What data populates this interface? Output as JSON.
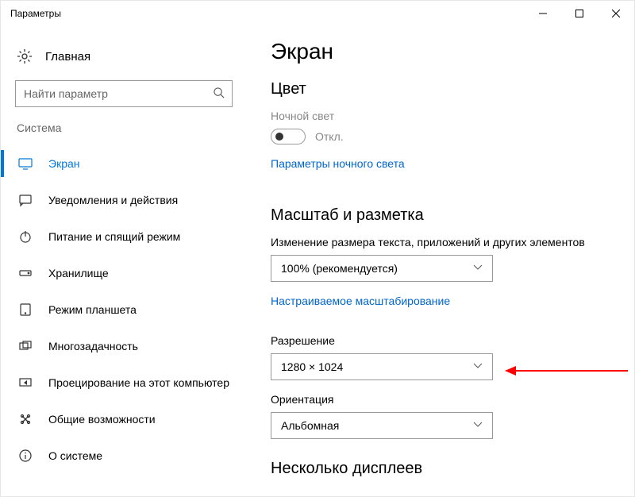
{
  "window": {
    "title": "Параметры"
  },
  "sidebar": {
    "home": "Главная",
    "search_placeholder": "Найти параметр",
    "category": "Система",
    "items": [
      {
        "label": "Экран"
      },
      {
        "label": "Уведомления и действия"
      },
      {
        "label": "Питание и спящий режим"
      },
      {
        "label": "Хранилище"
      },
      {
        "label": "Режим планшета"
      },
      {
        "label": "Многозадачность"
      },
      {
        "label": "Проецирование на этот компьютер"
      },
      {
        "label": "Общие возможности"
      },
      {
        "label": "О системе"
      }
    ]
  },
  "main": {
    "title": "Экран",
    "color_header": "Цвет",
    "night_light_label": "Ночной свет",
    "night_light_state": "Откл.",
    "night_light_link": "Параметры ночного света",
    "scale_header": "Масштаб и разметка",
    "scale_field_label": "Изменение размера текста, приложений и других элементов",
    "scale_value": "100% (рекомендуется)",
    "custom_scaling_link": "Настраиваемое масштабирование",
    "resolution_label": "Разрешение",
    "resolution_value": "1280 × 1024",
    "orientation_label": "Ориентация",
    "orientation_value": "Альбомная",
    "multi_display_header": "Несколько дисплеев"
  }
}
